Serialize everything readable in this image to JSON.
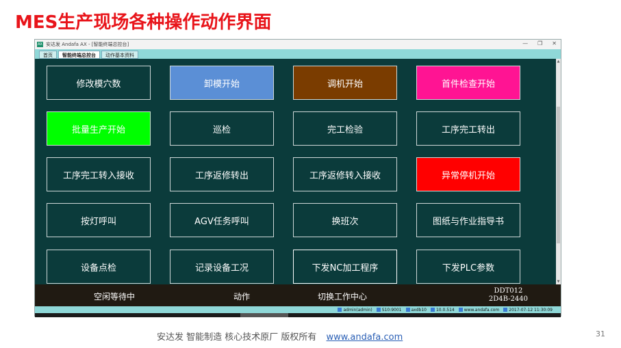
{
  "slide": {
    "title": "MES生产现场各种操作动作界面",
    "footer_text": "安达发   智能制造 核心技术原厂   版权所有",
    "footer_link": "www.andafa.com",
    "page_number": "31"
  },
  "window": {
    "title": "安达发 Andafa AX - [智能终端总控台]",
    "controls": [
      "—",
      "❐",
      "✕"
    ]
  },
  "tabs": [
    "首页",
    "智能终端总控台",
    "动作基本资料"
  ],
  "active_tab": 1,
  "buttons": [
    {
      "label": "修改模穴数",
      "color": "#0b3b3b"
    },
    {
      "label": "卸模开始",
      "color": "#5b8fd6"
    },
    {
      "label": "调机开始",
      "color": "#7a3c00"
    },
    {
      "label": "首件检查开始",
      "color": "#ff1493"
    },
    {
      "label": "批量生产开始",
      "color": "#00ff00"
    },
    {
      "label": "巡检",
      "color": "#0b3b3b"
    },
    {
      "label": "完工检验",
      "color": "#0b3b3b"
    },
    {
      "label": "工序完工转出",
      "color": "#0b3b3b"
    },
    {
      "label": "工序完工转入接收",
      "color": "#0b3b3b"
    },
    {
      "label": "工序返修转出",
      "color": "#0b3b3b"
    },
    {
      "label": "工序返修转入接收",
      "color": "#0b3b3b"
    },
    {
      "label": "异常停机开始",
      "color": "#ff0000"
    },
    {
      "label": "按灯呼叫",
      "color": "#0b3b3b"
    },
    {
      "label": "AGV任务呼叫",
      "color": "#0b3b3b"
    },
    {
      "label": "换班次",
      "color": "#0b3b3b"
    },
    {
      "label": "图纸与作业指导书",
      "color": "#0b3b3b"
    },
    {
      "label": "设备点检",
      "color": "#0b3b3b"
    },
    {
      "label": "记录设备工况",
      "color": "#0b3b3b"
    },
    {
      "label": "下发NC加工程序",
      "color": "#0b3b3b"
    },
    {
      "label": "下发PLC参数",
      "color": "#0b3b3b"
    }
  ],
  "status": {
    "state": "空闲等待中",
    "action": "动作",
    "switch": "切换工作中心",
    "code_line1": "DDT012",
    "code_line2": "2D4B-2440"
  },
  "infobar": {
    "user": "admin(admin)",
    "server": "S10:9001",
    "db": "axdb10",
    "version": "10.0.514",
    "site": "www.andafa.com",
    "datetime": "2017-07-12 11:30:09"
  }
}
